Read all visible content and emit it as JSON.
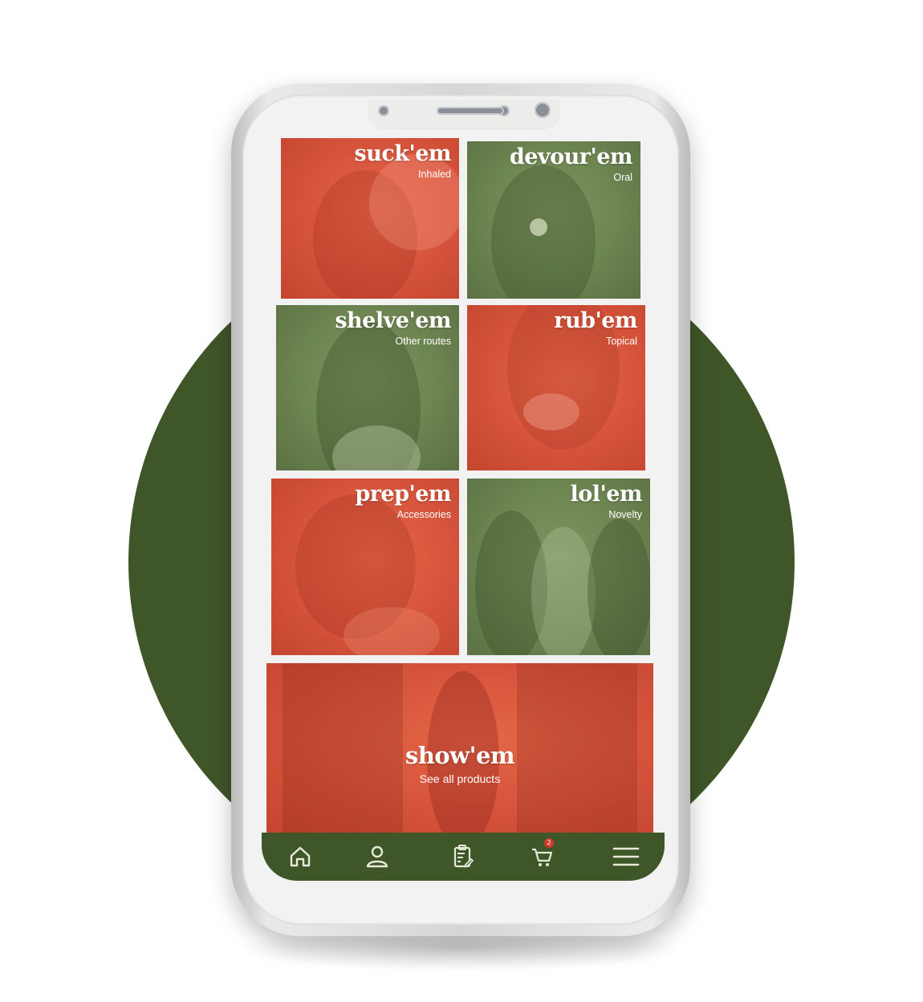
{
  "colors": {
    "brand_green": "#3f5629",
    "tile_red": "#d5533b",
    "tile_green": "#6c8450",
    "badge_red": "#d23a2a"
  },
  "categories": [
    {
      "title": "suck'em",
      "subtitle": "Inhaled",
      "tone": "red"
    },
    {
      "title": "devour'em",
      "subtitle": "Oral",
      "tone": "green"
    },
    {
      "title": "shelve'em",
      "subtitle": "Other routes",
      "tone": "green"
    },
    {
      "title": "rub'em",
      "subtitle": "Topical",
      "tone": "red"
    },
    {
      "title": "prep'em",
      "subtitle": "Accessories",
      "tone": "red"
    },
    {
      "title": "lol'em",
      "subtitle": "Novelty",
      "tone": "green"
    }
  ],
  "featured": {
    "title": "show'em",
    "subtitle": "See all products",
    "tone": "red"
  },
  "bottom_nav": {
    "items": [
      {
        "icon": "home-icon"
      },
      {
        "icon": "user-icon"
      },
      {
        "icon": "clipboard-icon"
      },
      {
        "icon": "cart-icon",
        "badge": "2"
      },
      {
        "icon": "menu-icon"
      }
    ]
  }
}
